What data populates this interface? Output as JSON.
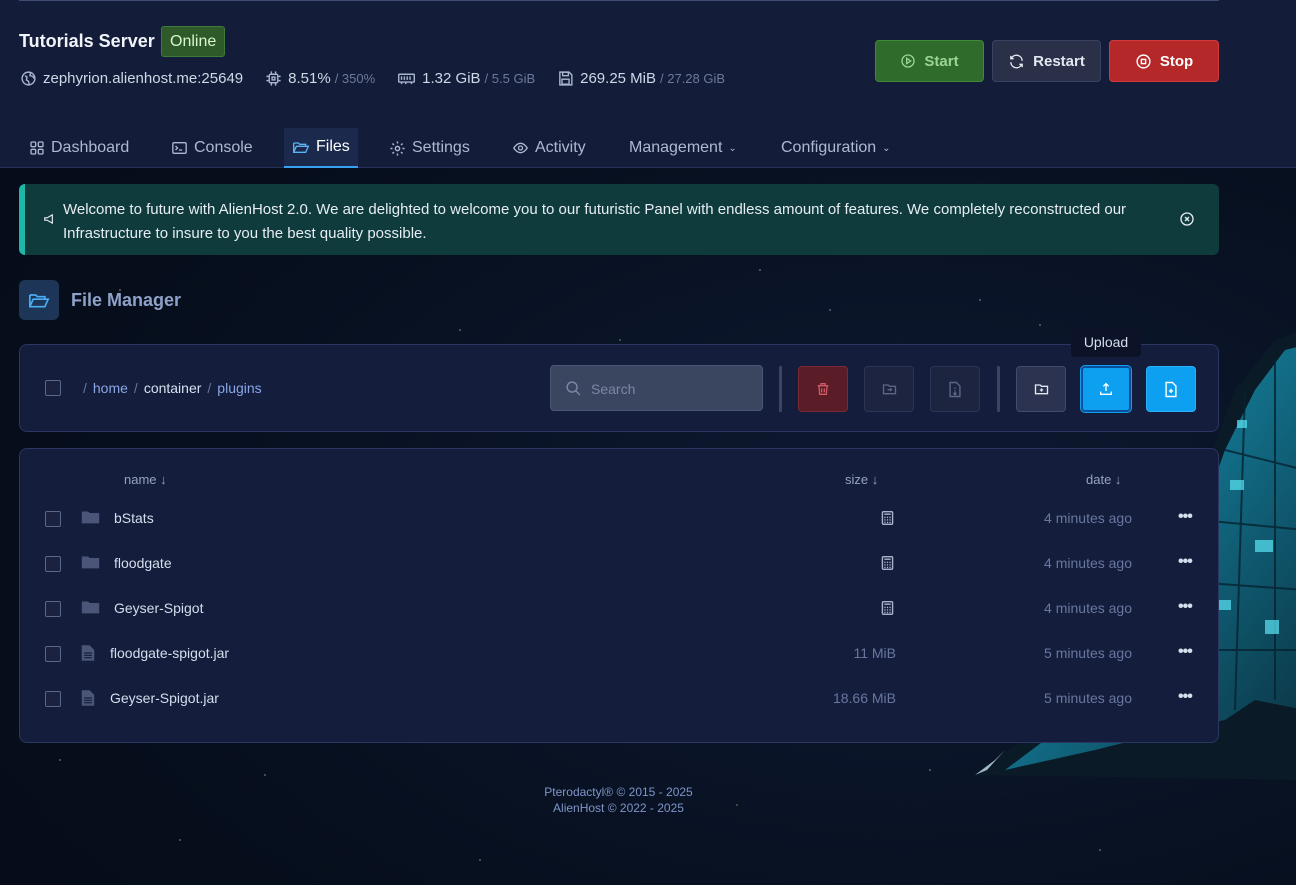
{
  "server": {
    "title": "Tutorials Server",
    "status": "Online",
    "address": "zephyrion.alienhost.me:25649",
    "cpu": {
      "value": "8.51%",
      "limit": "/ 350%"
    },
    "memory": {
      "value": "1.32 GiB",
      "limit": "/ 5.5 GiB"
    },
    "disk": {
      "value": "269.25 MiB",
      "limit": "/ 27.28 GiB"
    }
  },
  "power": {
    "start": "Start",
    "restart": "Restart",
    "stop": "Stop"
  },
  "tabs": [
    {
      "label": "Dashboard",
      "icon": "grid-icon"
    },
    {
      "label": "Console",
      "icon": "terminal-icon"
    },
    {
      "label": "Files",
      "icon": "folder-open-icon",
      "active": true
    },
    {
      "label": "Settings",
      "icon": "gear-icon"
    },
    {
      "label": "Activity",
      "icon": "eye-icon"
    },
    {
      "label": "Management",
      "dropdown": true
    },
    {
      "label": "Configuration",
      "dropdown": true
    }
  ],
  "alert": {
    "text": "Welcome to future with AlienHost 2.0. We are delighted to welcome you to our futuristic Panel with endless amount of features. We completely reconstructed our Infrastructure to insure to you the best quality possible."
  },
  "file_manager": {
    "title": "File Manager",
    "breadcrumb": [
      "home",
      "container",
      "plugins"
    ],
    "search_placeholder": "Search",
    "tooltip": "Upload",
    "columns": {
      "name": "name",
      "size": "size",
      "date": "date"
    },
    "files": [
      {
        "name": "bStats",
        "type": "folder",
        "size": "",
        "date": "4 minutes ago"
      },
      {
        "name": "floodgate",
        "type": "folder",
        "size": "",
        "date": "4 minutes ago"
      },
      {
        "name": "Geyser-Spigot",
        "type": "folder",
        "size": "",
        "date": "4 minutes ago"
      },
      {
        "name": "floodgate-spigot.jar",
        "type": "file",
        "size": "11 MiB",
        "date": "5 minutes ago"
      },
      {
        "name": "Geyser-Spigot.jar",
        "type": "file",
        "size": "18.66 MiB",
        "date": "5 minutes ago"
      }
    ]
  },
  "footer": {
    "line1": "Pterodactyl® © 2015 - 2025",
    "line2": "AlienHost © 2022 - 2025"
  },
  "colors": {
    "accent": "#0ea0f0",
    "start": "#2f6b2a",
    "stop": "#b5282a",
    "online": "#2e5a2a",
    "alert": "#0f3b3c"
  }
}
